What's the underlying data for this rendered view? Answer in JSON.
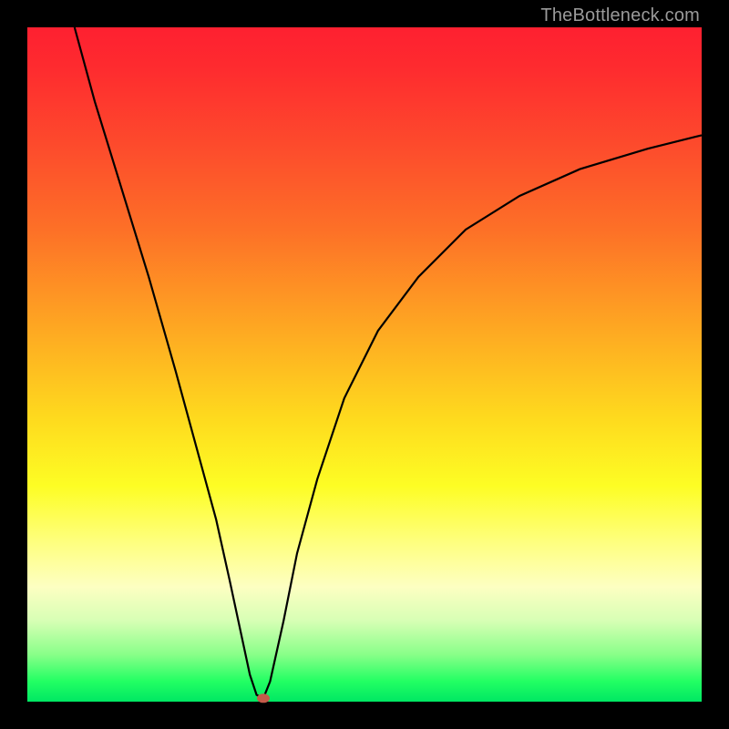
{
  "watermark": "TheBottleneck.com",
  "chart_data": {
    "type": "line",
    "title": "",
    "xlabel": "",
    "ylabel": "",
    "xlim": [
      0,
      100
    ],
    "ylim": [
      0,
      100
    ],
    "series": [
      {
        "name": "curve",
        "x": [
          7,
          10,
          14,
          18,
          22,
          25,
          28,
          30,
          31.5,
          33,
          34,
          35,
          36,
          38,
          40,
          43,
          47,
          52,
          58,
          65,
          73,
          82,
          92,
          100
        ],
        "y": [
          100,
          89,
          76,
          63,
          49,
          38,
          27,
          18,
          11,
          4,
          1,
          0.5,
          3,
          12,
          22,
          33,
          45,
          55,
          63,
          70,
          75,
          79,
          82,
          84
        ]
      }
    ],
    "marker": {
      "x": 35,
      "y": 0.5,
      "color": "#c45b4a"
    },
    "background_gradient": [
      "#fe2030",
      "#feda1e",
      "#00e763"
    ]
  }
}
